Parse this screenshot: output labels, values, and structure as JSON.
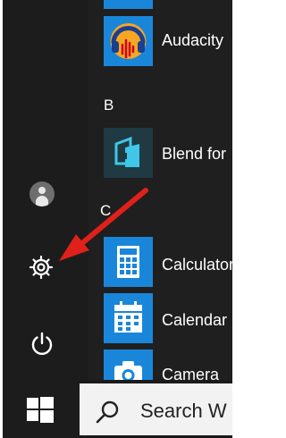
{
  "apps": [
    {
      "label": "Audacity",
      "icon": "audacity-icon"
    },
    {
      "label": "Blend for",
      "icon": "blend-icon"
    },
    {
      "label": "Calculator",
      "icon": "calculator-icon"
    },
    {
      "label": "Calendar",
      "icon": "calendar-icon"
    },
    {
      "label": "Camera",
      "icon": "camera-icon"
    }
  ],
  "section_letters": {
    "b": "B",
    "c": "C"
  },
  "rail_icons": [
    "user-avatar",
    "gear-icon",
    "power-icon"
  ],
  "taskbar": {
    "start_icon": "windows-logo-icon",
    "search_label": "Search W"
  },
  "annotation": {
    "arrow_color": "#e0201b",
    "points_to": "gear-icon"
  },
  "colors": {
    "tile_blue": "#1a86d9",
    "background": "#1f1f1f"
  }
}
